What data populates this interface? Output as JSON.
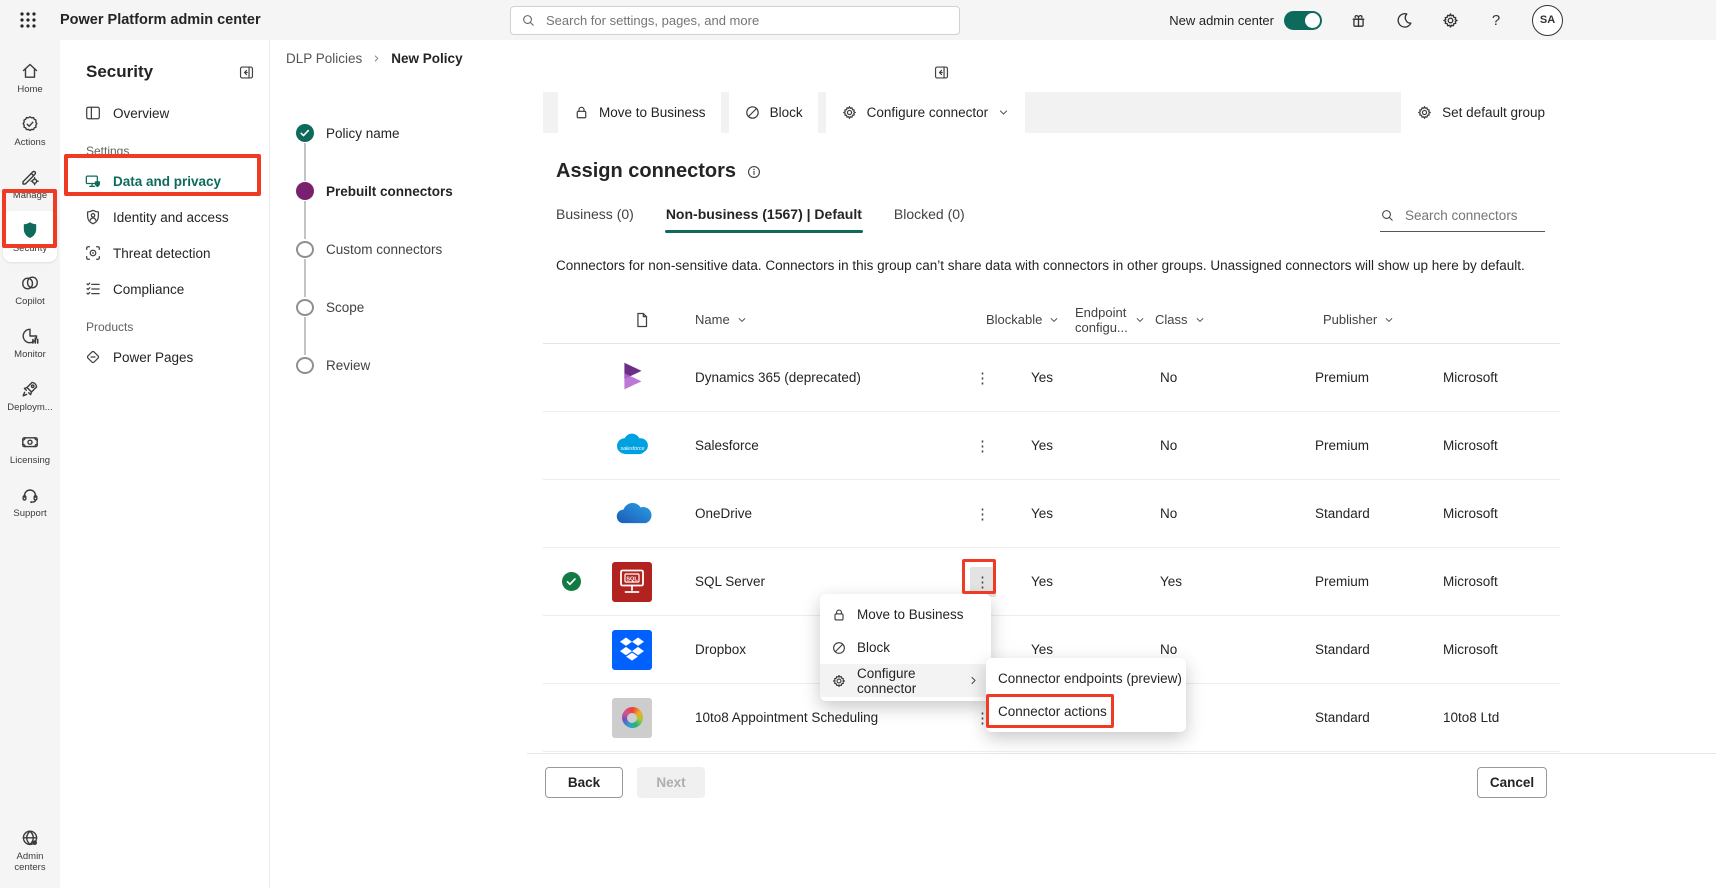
{
  "colors": {
    "accent_teal": "#0e6b5c",
    "step_purple": "#77216f",
    "annotation_red": "#ef3b24",
    "selected_green": "#127a43",
    "topbar_bg": "#f5f5f5"
  },
  "topbar": {
    "app_title": "Power Platform admin center",
    "search_placeholder": "Search for settings, pages, and more",
    "new_admin_center_label": "New admin center",
    "toggle_on": true,
    "avatar_initials": "SA"
  },
  "rail": {
    "items": [
      {
        "id": "home",
        "label": "Home",
        "icon": "home-icon"
      },
      {
        "id": "actions",
        "label": "Actions",
        "icon": "actions-icon"
      },
      {
        "id": "manage",
        "label": "Manage",
        "icon": "manage-icon"
      },
      {
        "id": "security",
        "label": "Security",
        "icon": "shield-icon",
        "active": true
      },
      {
        "id": "copilot",
        "label": "Copilot",
        "icon": "copilot-icon"
      },
      {
        "id": "monitor",
        "label": "Monitor",
        "icon": "monitor-icon"
      },
      {
        "id": "deployment",
        "label": "Deploym...",
        "icon": "rocket-icon"
      },
      {
        "id": "licensing",
        "label": "Licensing",
        "icon": "banknote-icon"
      },
      {
        "id": "support",
        "label": "Support",
        "icon": "headset-icon"
      }
    ],
    "bottom": {
      "id": "admin-centers",
      "label": "Admin centers",
      "icon": "globe-icon"
    }
  },
  "sidebar": {
    "title": "Security",
    "entries": [
      {
        "type": "item",
        "id": "overview",
        "label": "Overview",
        "icon": "overview-icon"
      },
      {
        "type": "section",
        "label": "Settings"
      },
      {
        "type": "item",
        "id": "data-and-privacy",
        "label": "Data and privacy",
        "icon": "data-privacy-icon",
        "active": true
      },
      {
        "type": "item",
        "id": "identity-and-access",
        "label": "Identity and access",
        "icon": "identity-icon"
      },
      {
        "type": "item",
        "id": "threat-detection",
        "label": "Threat detection",
        "icon": "threat-icon"
      },
      {
        "type": "item",
        "id": "compliance",
        "label": "Compliance",
        "icon": "compliance-icon"
      },
      {
        "type": "section",
        "label": "Products"
      },
      {
        "type": "item",
        "id": "power-pages",
        "label": "Power Pages",
        "icon": "power-pages-icon"
      }
    ]
  },
  "breadcrumb": {
    "items": [
      {
        "label": "DLP Policies",
        "current": false
      },
      {
        "label": "New Policy",
        "current": true
      }
    ]
  },
  "wizard": {
    "steps": [
      {
        "label": "Policy name",
        "state": "complete"
      },
      {
        "label": "Prebuilt connectors",
        "state": "current"
      },
      {
        "label": "Custom connectors",
        "state": "upcoming"
      },
      {
        "label": "Scope",
        "state": "upcoming"
      },
      {
        "label": "Review",
        "state": "upcoming"
      }
    ]
  },
  "toolbar": {
    "buttons": [
      {
        "id": "move-to-business",
        "label": "Move to Business",
        "icon": "lock-icon"
      },
      {
        "id": "block",
        "label": "Block",
        "icon": "block-icon"
      },
      {
        "id": "configure-connector",
        "label": "Configure connector",
        "icon": "gear-icon",
        "dropdown": true
      }
    ],
    "right": {
      "id": "set-default-group",
      "label": "Set default group",
      "icon": "gear-icon"
    }
  },
  "content": {
    "title": "Assign connectors",
    "tabs": [
      {
        "label": "Business (0)",
        "active": false
      },
      {
        "label": "Non-business (1567) | Default",
        "active": true
      },
      {
        "label": "Blocked (0)",
        "active": false
      }
    ],
    "search_placeholder": "Search connectors",
    "description": "Connectors for non-sensitive data. Connectors in this group can’t share data with connectors in other groups. Unassigned connectors will show up here by default.",
    "table": {
      "columns": [
        {
          "label": "Name"
        },
        {
          "label": "Blockable"
        },
        {
          "label": "Endpoint configu..."
        },
        {
          "label": "Class"
        },
        {
          "label": "Publisher"
        }
      ],
      "rows": [
        {
          "name": "Dynamics 365 (deprecated)",
          "logo": "dynamics365-logo",
          "blockable": "Yes",
          "endpoint": "No",
          "class": "Premium",
          "publisher": "Microsoft",
          "selected": false,
          "kebab_pressed": false
        },
        {
          "name": "Salesforce",
          "logo": "salesforce-logo",
          "blockable": "Yes",
          "endpoint": "No",
          "class": "Premium",
          "publisher": "Microsoft",
          "selected": false,
          "kebab_pressed": false
        },
        {
          "name": "OneDrive",
          "logo": "onedrive-logo",
          "blockable": "Yes",
          "endpoint": "No",
          "class": "Standard",
          "publisher": "Microsoft",
          "selected": false,
          "kebab_pressed": false
        },
        {
          "name": "SQL Server",
          "logo": "sqlserver-logo",
          "blockable": "Yes",
          "endpoint": "Yes",
          "class": "Premium",
          "publisher": "Microsoft",
          "selected": true,
          "kebab_pressed": true
        },
        {
          "name": "Dropbox",
          "logo": "dropbox-logo",
          "blockable": "Yes",
          "endpoint": "No",
          "class": "Standard",
          "publisher": "Microsoft",
          "selected": false,
          "kebab_pressed": false
        },
        {
          "name": "10to8 Appointment Scheduling",
          "logo": "tento8-logo",
          "blockable": "",
          "endpoint": "",
          "class": "Standard",
          "publisher": "10to8 Ltd",
          "selected": false,
          "kebab_pressed": false
        }
      ]
    },
    "footer": {
      "back_label": "Back",
      "next_label": "Next",
      "next_disabled": true,
      "cancel_label": "Cancel"
    }
  },
  "context_menu": {
    "items": [
      {
        "label": "Move to Business",
        "icon": "lock-icon",
        "highlight": false
      },
      {
        "label": "Block",
        "icon": "block-icon",
        "highlight": false
      },
      {
        "label": "Configure connector",
        "icon": "gear-icon",
        "highlight": true,
        "submenu_open": true
      }
    ],
    "submenu": {
      "items": [
        {
          "label": "Connector endpoints (preview)"
        },
        {
          "label": "Connector actions"
        }
      ]
    }
  }
}
